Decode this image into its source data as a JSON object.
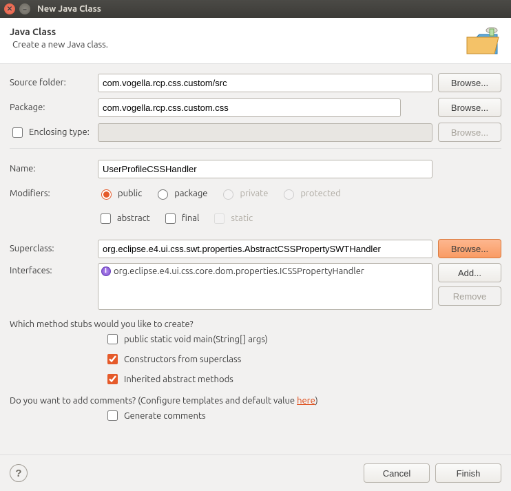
{
  "window": {
    "title": "New Java Class"
  },
  "banner": {
    "title": "Java Class",
    "description": "Create a new Java class."
  },
  "fields": {
    "sourceFolder": {
      "label": "Source folder:",
      "value": "com.vogella.rcp.css.custom/src"
    },
    "package": {
      "label": "Package:",
      "value": "com.vogella.rcp.css.custom.css"
    },
    "enclosingType": {
      "label": "Enclosing type:",
      "value": ""
    },
    "name": {
      "label": "Name:",
      "value": "UserProfileCSSHandler"
    },
    "modifiers": {
      "label": "Modifiers:"
    },
    "superclass": {
      "label": "Superclass:",
      "value": "org.eclipse.e4.ui.css.swt.properties.AbstractCSSPropertySWTHandler"
    },
    "interfaces": {
      "label": "Interfaces:",
      "items": [
        "org.eclipse.e4.ui.css.core.dom.properties.ICSSPropertyHandler"
      ]
    }
  },
  "modifiers": {
    "visibility": {
      "public": "public",
      "package": "package",
      "private": "private",
      "protected": "protected"
    },
    "other": {
      "abstract": "abstract",
      "final": "final",
      "static": "static"
    }
  },
  "buttons": {
    "browse": "Browse...",
    "add": "Add...",
    "remove": "Remove",
    "cancel": "Cancel",
    "finish": "Finish"
  },
  "stubs": {
    "question": "Which method stubs would you like to create?",
    "main": "public static void main(String[] args)",
    "constructors": "Constructors from superclass",
    "inherited": "Inherited abstract methods"
  },
  "comments": {
    "question_prefix": "Do you want to add comments? (Configure templates and default value ",
    "link": "here",
    "question_suffix": ")",
    "generate": "Generate comments"
  }
}
